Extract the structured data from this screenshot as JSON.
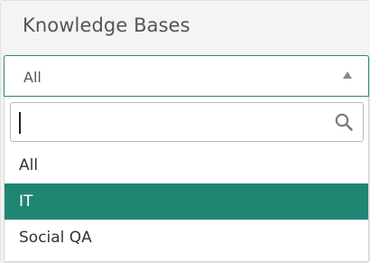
{
  "header": {
    "title": "Knowledge Bases"
  },
  "select": {
    "value": "All"
  },
  "search": {
    "value": "",
    "placeholder": ""
  },
  "options": [
    {
      "label": "All",
      "selected": false
    },
    {
      "label": "IT",
      "selected": true
    },
    {
      "label": "Social QA",
      "selected": false
    }
  ],
  "colors": {
    "accent": "#208674",
    "border_focus": "#2a8a78"
  },
  "icons": {
    "search": "search-icon",
    "caret": "caret-up-icon"
  }
}
